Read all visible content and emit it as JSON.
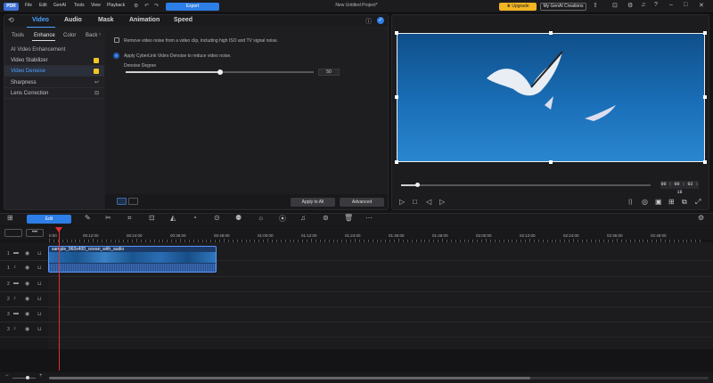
{
  "app": {
    "logo": "PDR",
    "project_title": "New Untitled Project*"
  },
  "menu": [
    "File",
    "Edit",
    "GenAI",
    "Tools",
    "View",
    "Playback"
  ],
  "titlebar": {
    "export_label": "Export",
    "upgrade_label": "Upgrade",
    "genai_label": "My GenAI Creations"
  },
  "edit_panel": {
    "tabs": [
      "Video",
      "Audio",
      "Mask",
      "Animation",
      "Speed"
    ],
    "subtabs": [
      "Tools",
      "Enhance",
      "Color",
      "Back"
    ],
    "list_header": "AI Video Enhancement",
    "items": [
      "Video Stabilizer",
      "Video Denoise",
      "Sharpness",
      "Lens Correction"
    ],
    "option1": "Remove video noise from a video clip, including high ISO and TV signal noise.",
    "option2": "Apply CyberLink Video Denoise to reduce video noise.",
    "degree_label": "Denoise Degree",
    "degree_value": "50",
    "degree_fraction": 0.5,
    "apply_all": "Apply to All",
    "advanced": "Advanced"
  },
  "preview": {
    "timecode": "00 : 00 : 02 : 18",
    "progress_fraction": 0.06
  },
  "timeline": {
    "edit_label": "Edit",
    "ruler": [
      "0:00",
      "00:12:00",
      "00:24:00",
      "00:36:00",
      "00:48:00",
      "01:00:00",
      "01:12:00",
      "01:24:00",
      "01:36:00",
      "01:48:00",
      "02:00:00",
      "02:12:00",
      "02:24:00",
      "02:36:00",
      "02:48:00"
    ],
    "tracks": [
      "1",
      "1",
      "2",
      "2",
      "3",
      "3"
    ],
    "clip_label": "sample_960x400_ocean_with_audio"
  },
  "colors": {
    "accent": "#2d7ee6",
    "upgrade": "#f2b523",
    "active_tab": "#4da3ff",
    "playhead": "#e03030"
  }
}
